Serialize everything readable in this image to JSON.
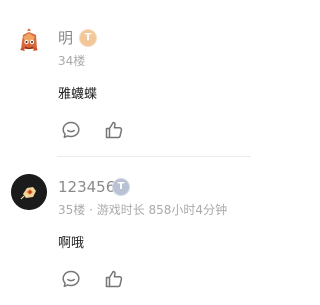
{
  "comments": [
    {
      "username": "明",
      "badge": "T",
      "meta": "34楼",
      "content": "雅蠛蝶",
      "avatar_icon": "cartoon-character-avatar",
      "badge_color": "#f2c79a"
    },
    {
      "username": "123456",
      "badge": "T",
      "meta": "35楼 · 游戏时长 858小时4分钟",
      "content": "啊哦",
      "avatar_icon": "dark-round-avatar",
      "badge_color": "#b9c2d4"
    }
  ],
  "icons": {
    "reply": "comment-bubble-icon",
    "like": "thumbs-up-icon"
  },
  "colors": {
    "username": "#8a8a8a",
    "meta": "#aaaaaa",
    "content": "#222222",
    "icon": "#777777"
  }
}
